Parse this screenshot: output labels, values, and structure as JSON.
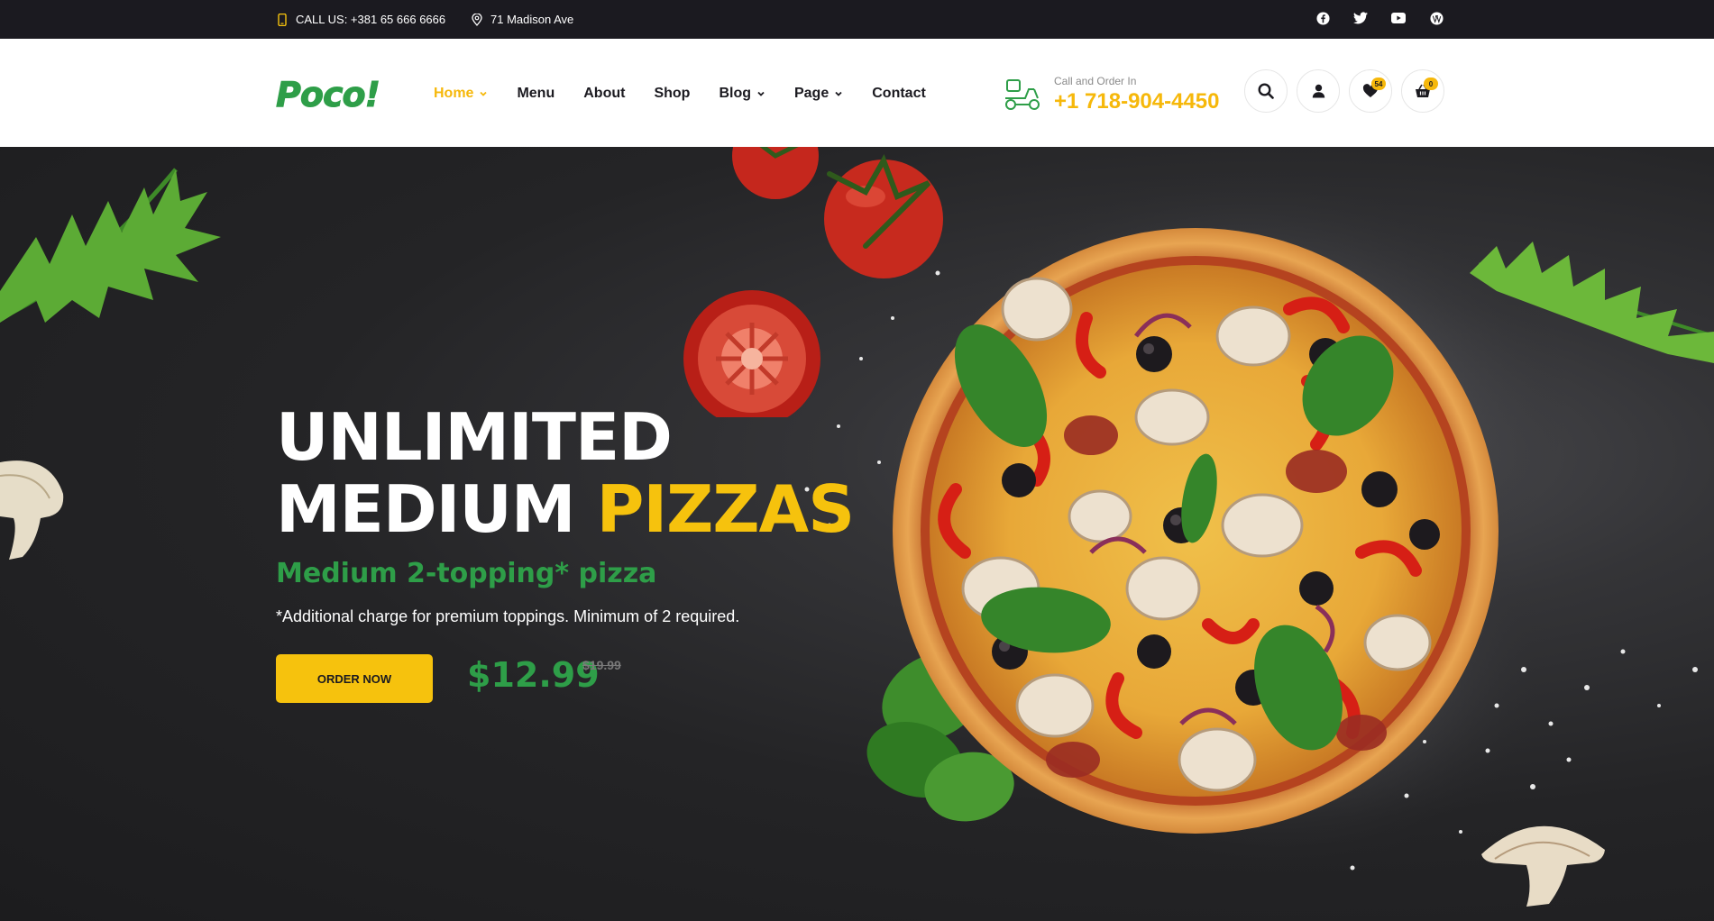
{
  "topbar": {
    "call": "CALL US: +381 65 666 6666",
    "address": "71 Madison Ave",
    "social": [
      "facebook-icon",
      "twitter-icon",
      "youtube-icon",
      "wordpress-icon"
    ]
  },
  "header": {
    "logo": "Poco!",
    "nav": [
      {
        "label": "Home",
        "dropdown": true,
        "active": true
      },
      {
        "label": "Menu",
        "dropdown": false
      },
      {
        "label": "About",
        "dropdown": false
      },
      {
        "label": "Shop",
        "dropdown": false
      },
      {
        "label": "Blog",
        "dropdown": true
      },
      {
        "label": "Page",
        "dropdown": true
      },
      {
        "label": "Contact",
        "dropdown": false
      }
    ],
    "call_label": "Call and Order In",
    "call_phone": "+1 718-904-4450",
    "wishlist_count": "54",
    "cart_count": "0"
  },
  "hero": {
    "title_line1": "UNLIMITED",
    "title_line2_white": "MEDIUM ",
    "title_line2_accent": "PIZZAS",
    "subtitle": "Medium 2-topping* pizza",
    "note": "*Additional charge for premium toppings. Minimum of 2 required.",
    "cta": "ORDER NOW",
    "price": "$12.99",
    "old_price": "$19.99"
  },
  "colors": {
    "accent_yellow": "#f6c20d",
    "brand_green": "#2e9e48",
    "dark": "#1b1a20"
  }
}
